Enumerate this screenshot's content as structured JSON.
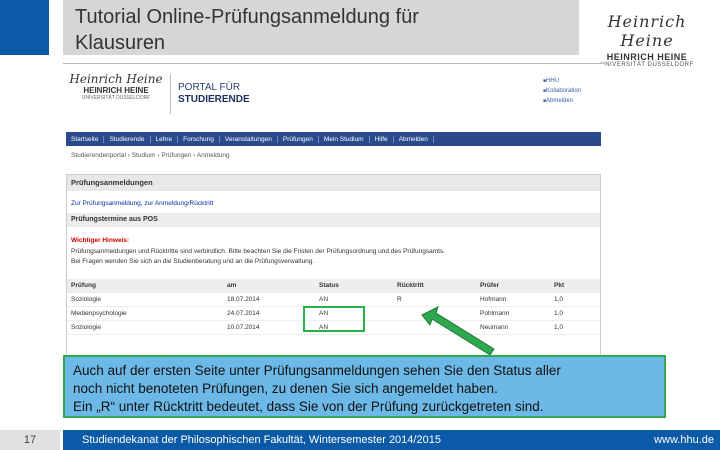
{
  "slide": {
    "title": "Tutorial Online-Prüfungsanmeldung für\nKlausuren",
    "logo": {
      "script": "Heinrich Heine",
      "name": "HEINRICH HEINE",
      "sub": "UNIVERSITÄT DÜSSELDORF"
    },
    "callout": "Auch auf der ersten Seite unter Prüfungsanmeldungen sehen Sie den Status aller\nnoch nicht benoteten Prüfungen, zu denen Sie sich angemeldet haben.\nEin „R“ unter Rücktritt bedeutet, dass Sie von der Prüfung zurückgetreten sind.",
    "page_number": "17",
    "footer_left": "Studiendekanat der Philosophischen Fakultät, Wintersemester 2014/2015",
    "footer_right": "www.hhu.de",
    "colors": {
      "accent_blue": "#0b5aa7",
      "callout_bg": "#6cb8e6",
      "highlight_green": "#22b34a"
    }
  },
  "portal": {
    "logo_script": "Heinrich Heine",
    "logo_name": "HEINRICH HEINE",
    "logo_sub": "UNIVERSITÄT DÜSSELDORF",
    "portal_line1": "PORTAL FÜR",
    "portal_line2": "STUDIERENDE",
    "top_links": [
      "HHU",
      "Kollaboration",
      "Abmelden"
    ],
    "nav": [
      "Startseite",
      "Studierende",
      "Lehre",
      "Forschung",
      "Veranstaltungen",
      "Prüfungen",
      "Mein Studium",
      "Hilfe",
      "Abmelden"
    ],
    "breadcrumb": "Studierendenportal  ›  Studium  ›  Prüfungen  ›  Anmeldung",
    "section_title": "Prüfungsanmeldungen",
    "link_text": "Zur Prüfungsanmeldung, zur Anmeldung/Rücktritt",
    "subsection_title": "Prüfungstermine aus POS",
    "warning_title": "Wichtiger Hinweis:",
    "info_line1": "Prüfungsanmeldungen und Rücktritte sind verbindlich. Bitte beachten Sie die Fristen der Prüfungsordnung und des Prüfungsamts.",
    "info_line2": "Bei Fragen wenden Sie sich an die Studienberatung und an die Prüfungsverwaltung.",
    "table": {
      "headers": [
        "Prüfung",
        "am",
        "Status",
        "Rücktritt",
        "Prüfer",
        "Pkt"
      ],
      "rows": [
        [
          "Soziologie",
          "18.07.2014",
          "AN",
          "R",
          "Hofmann",
          "1,0"
        ],
        [
          "Medienpsychologie",
          "24.07.2014",
          "AN",
          "",
          "Pohlmann",
          "1,0"
        ],
        [
          "Soziologie",
          "10.07.2014",
          "AN",
          "",
          "Neumann",
          "1,0"
        ]
      ]
    }
  }
}
